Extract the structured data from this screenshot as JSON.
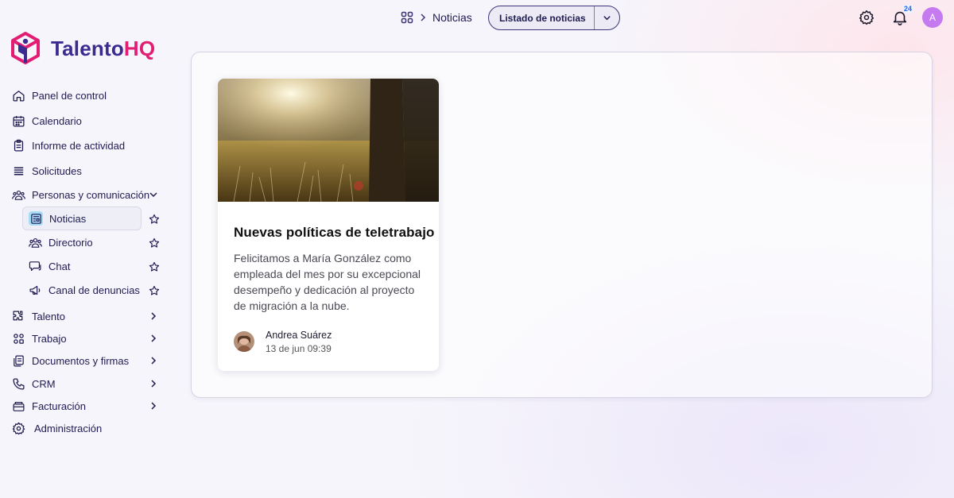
{
  "brand": {
    "name_part1": "Talento",
    "name_part2": "HQ",
    "colors": {
      "primary": "#3b2a8f",
      "accent": "#e11d74"
    }
  },
  "sidebar": {
    "items": [
      {
        "label": "Panel de control",
        "icon": "home-icon"
      },
      {
        "label": "Calendario",
        "icon": "calendar-icon"
      },
      {
        "label": "Informe de actividad",
        "icon": "clipboard-icon"
      },
      {
        "label": "Solicitudes",
        "icon": "list-icon"
      },
      {
        "label": "Personas y comunicación",
        "icon": "people-icon",
        "expanded": true
      },
      {
        "label": "Talento",
        "icon": "puzzle-icon"
      },
      {
        "label": "Trabajo",
        "icon": "grid-icon"
      },
      {
        "label": "Documentos y firmas",
        "icon": "documents-icon"
      },
      {
        "label": "CRM",
        "icon": "phone-icon"
      },
      {
        "label": "Facturación",
        "icon": "wallet-icon"
      },
      {
        "label": "Administración",
        "icon": "gear-icon"
      }
    ],
    "subitems": [
      {
        "label": "Noticias",
        "icon": "newspaper-icon",
        "active": true
      },
      {
        "label": "Directorio",
        "icon": "people-icon"
      },
      {
        "label": "Chat",
        "icon": "chat-icon"
      },
      {
        "label": "Canal de denuncias",
        "icon": "megaphone-icon"
      }
    ]
  },
  "topbar": {
    "breadcrumb_current": "Noticias",
    "view_select": "Listado de noticias",
    "notifications_count": "24",
    "user_initial": "A"
  },
  "news": [
    {
      "title": "Nuevas políticas de teletrabajo",
      "body": "Felicitamos a María González como empleada del mes por su excepcional desempeño y dedicación al proyecto de migración a la nube.",
      "author": "Andrea Suárez",
      "date": "13 de jun 09:39"
    }
  ]
}
